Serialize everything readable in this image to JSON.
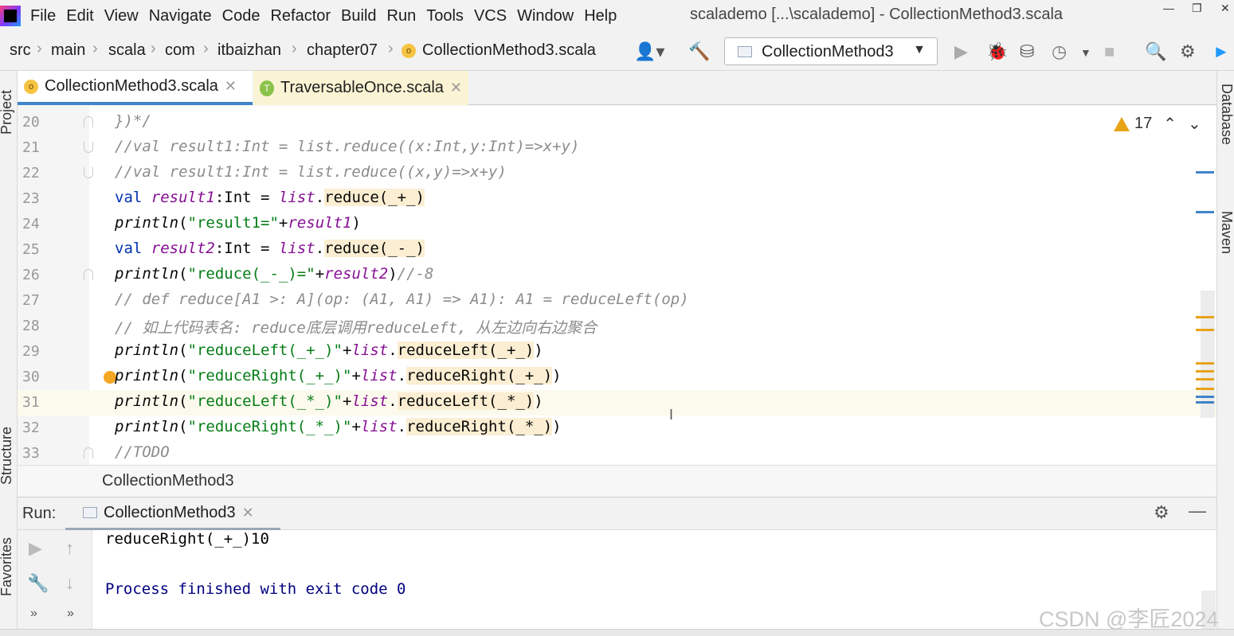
{
  "menubar": {
    "items": [
      "File",
      "Edit",
      "View",
      "Navigate",
      "Code",
      "Refactor",
      "Build",
      "Run",
      "Tools",
      "VCS",
      "Window",
      "Help"
    ],
    "window_title": "scalademo [...\\scalademo] - CollectionMethod3.scala"
  },
  "navbar": {
    "breadcrumbs": [
      "src",
      "main",
      "scala",
      "com",
      "itbaizhan",
      "chapter07",
      "CollectionMethod3.scala"
    ],
    "run_config": "CollectionMethod3"
  },
  "tabs": [
    {
      "label": "CollectionMethod3.scala",
      "icon": "scala-object-icon"
    },
    {
      "label": "TraversableOnce.scala",
      "icon": "scala-trait-icon"
    }
  ],
  "editor": {
    "warnings_count": "17",
    "lines": [
      {
        "num": "20",
        "code": "})*/"
      },
      {
        "num": "21",
        "code": "//val result1:Int = list.reduce((x:Int,y:Int)=>x+y)"
      },
      {
        "num": "22",
        "code": "//val result1:Int = list.reduce((x,y)=>x+y)"
      },
      {
        "num": "23",
        "code": "val result1:Int = list.reduce(_+_)"
      },
      {
        "num": "24",
        "code": "println(\"result1=\"+result1)"
      },
      {
        "num": "25",
        "code": "val result2:Int = list.reduce(_-_)"
      },
      {
        "num": "26",
        "code": "println(\"reduce(_-_)=\"+result2)//-8"
      },
      {
        "num": "27",
        "code": "// def reduce[A1 >: A](op: (A1, A1) => A1): A1 = reduceLeft(op)"
      },
      {
        "num": "28",
        "code": "// 如上代码表名: reduce底层调用reduceLeft, 从左边向右边聚合"
      },
      {
        "num": "29",
        "code": "println(\"reduceLeft(_+_)\"+list.reduceLeft(_+_))"
      },
      {
        "num": "30",
        "code": "println(\"reduceRight(_+_)\"+list.reduceRight(_+_))"
      },
      {
        "num": "31",
        "code": "println(\"reduceLeft(_*_)\"+list.reduceLeft(_*_))"
      },
      {
        "num": "32",
        "code": "println(\"reduceRight(_*_)\"+list.reduceRight(_*_))"
      },
      {
        "num": "33",
        "code": "//TODO"
      }
    ],
    "footer": "CollectionMethod3"
  },
  "left_tabs": [
    "Project",
    "Structure",
    "Favorites"
  ],
  "right_tabs": [
    "Database",
    "Maven"
  ],
  "run": {
    "label": "Run:",
    "tab": "CollectionMethod3",
    "output": [
      "reduceRight(_+_)10",
      "",
      "Process finished with exit code 0"
    ]
  },
  "watermark": "CSDN @李匠2024",
  "colors": {
    "keyword": "#0033b3",
    "string": "#067d17",
    "field": "#871094",
    "comment": "#8c8c8c",
    "console": "#000080",
    "accent": "#4083c9"
  }
}
